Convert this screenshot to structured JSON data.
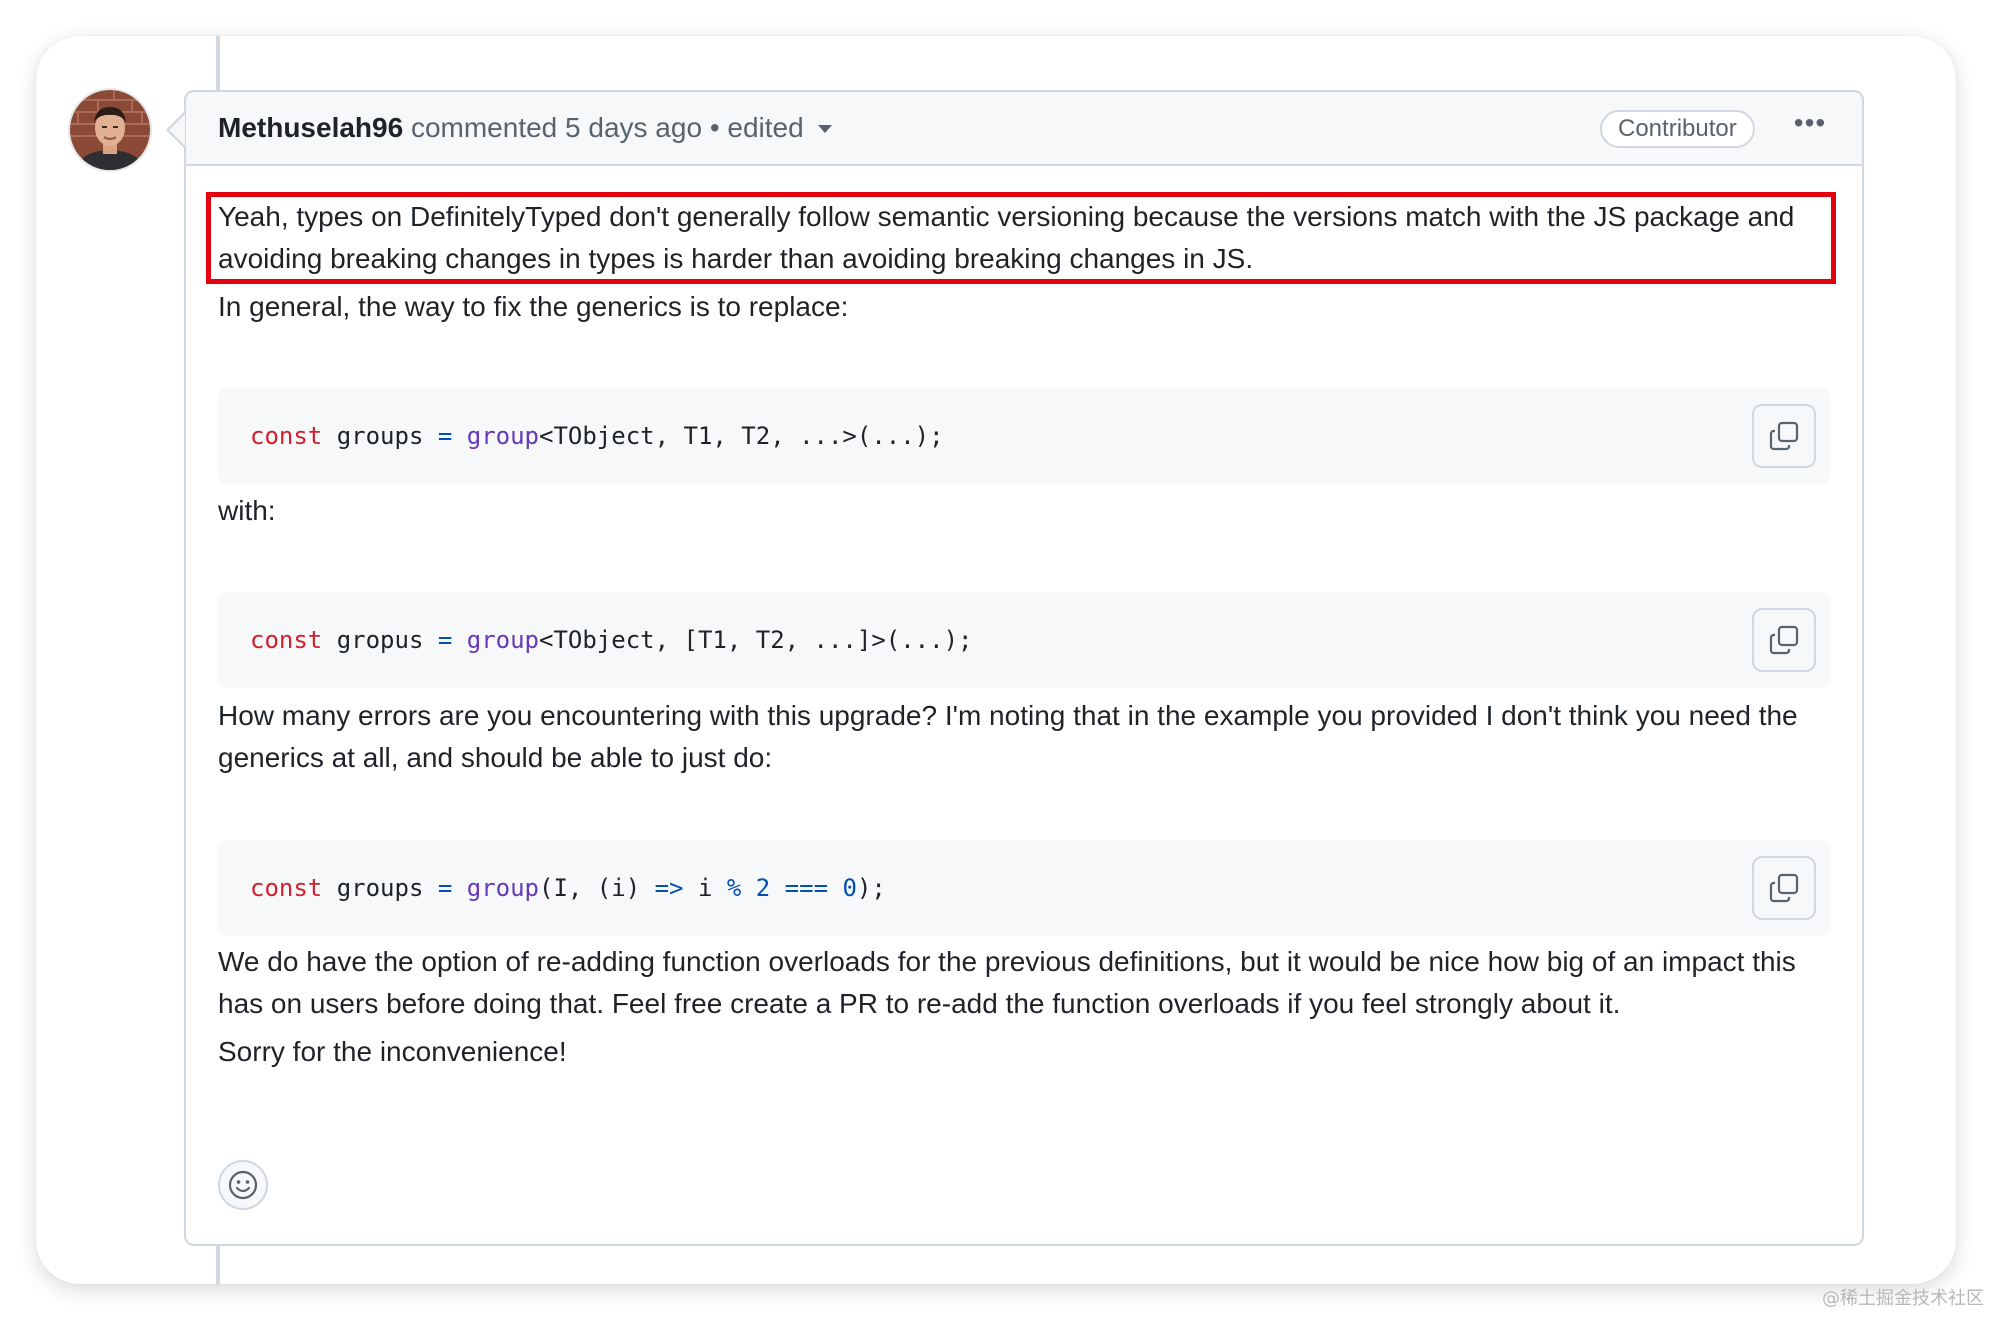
{
  "comment": {
    "author": "Methuselah96",
    "action": "commented",
    "time": "5 days ago",
    "separator": "•",
    "edited_label": "edited",
    "role_badge": "Contributor",
    "menu_label": "•••",
    "paragraphs": [
      "Yeah, types on DefinitelyTyped don't generally follow semantic versioning because the versions match with the JS package and avoiding breaking changes in types is harder than avoiding breaking changes in JS.",
      "In general, the way to fix the generics is to replace:",
      "with:",
      "How many errors are you encountering with this upgrade? I'm noting that in the example you provided I don't think you need the generics at all, and should be able to just do:",
      "We do have the option of re-adding function overloads for the previous definitions, but it would be nice how big of an impact this has on users before doing that. Feel free create a PR to re-add the function overloads if you feel strongly about it.",
      "Sorry for the inconvenience!"
    ],
    "code_blocks": [
      {
        "tokens": [
          {
            "t": "const",
            "k": "kw"
          },
          {
            "t": " groups "
          },
          {
            "t": "=",
            "k": "op"
          },
          {
            "t": " "
          },
          {
            "t": "group",
            "k": "fn"
          },
          {
            "t": "<TObject, T1, T2, ...>(...);"
          }
        ]
      },
      {
        "tokens": [
          {
            "t": "const",
            "k": "kw"
          },
          {
            "t": " gropus "
          },
          {
            "t": "=",
            "k": "op"
          },
          {
            "t": " "
          },
          {
            "t": "group",
            "k": "fn"
          },
          {
            "t": "<TObject, [T1, T2, ...]>(...);"
          }
        ]
      },
      {
        "tokens": [
          {
            "t": "const",
            "k": "kw"
          },
          {
            "t": " groups "
          },
          {
            "t": "=",
            "k": "op"
          },
          {
            "t": " "
          },
          {
            "t": "group",
            "k": "fn"
          },
          {
            "t": "(I, (i) "
          },
          {
            "t": "=>",
            "k": "op"
          },
          {
            "t": " i "
          },
          {
            "t": "%",
            "k": "op"
          },
          {
            "t": " "
          },
          {
            "t": "2",
            "k": "num"
          },
          {
            "t": " "
          },
          {
            "t": "===",
            "k": "op"
          },
          {
            "t": " "
          },
          {
            "t": "0",
            "k": "num"
          },
          {
            "t": ");"
          }
        ]
      }
    ]
  },
  "watermark": "@稀土掘金技术社区",
  "colors": {
    "highlight_border": "#e3000f",
    "keyword": "#cf222e",
    "function": "#6639ba",
    "operator": "#0550ae"
  },
  "icons": [
    "avatar",
    "chevron-down-icon",
    "kebab-menu-icon",
    "copy-icon",
    "smiley-icon"
  ]
}
